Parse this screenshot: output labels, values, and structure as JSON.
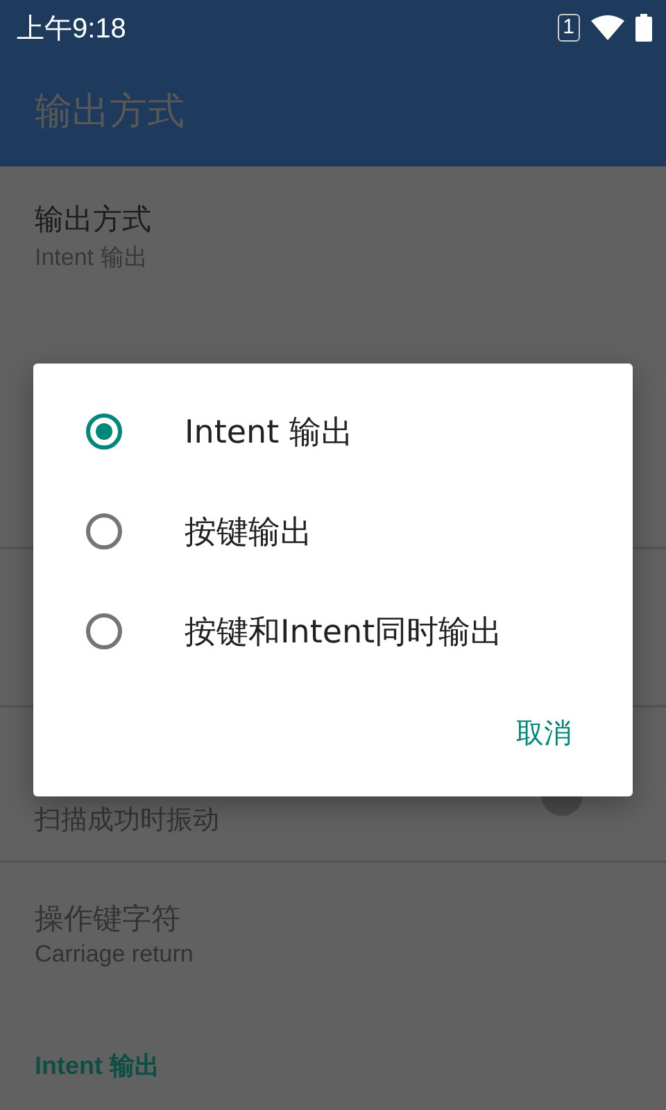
{
  "status_bar": {
    "time": "上午9:18",
    "sim": "1"
  },
  "app_bar": {
    "title": "输出方式"
  },
  "settings": [
    {
      "kind": "text",
      "title": "输出方式",
      "summary": "Intent 输出",
      "disabled": false
    },
    {
      "kind": "switch",
      "summary": "扫描成功时振动",
      "on": false
    },
    {
      "kind": "text",
      "title": "操作键字符",
      "summary": "Carriage return",
      "disabled": true
    }
  ],
  "category": "Intent 输出",
  "dialog": {
    "options": [
      {
        "label": "Intent 输出",
        "selected": true
      },
      {
        "label": "按键输出",
        "selected": false
      },
      {
        "label": "按键和Intent同时输出",
        "selected": false
      }
    ],
    "cancel": "取消"
  }
}
